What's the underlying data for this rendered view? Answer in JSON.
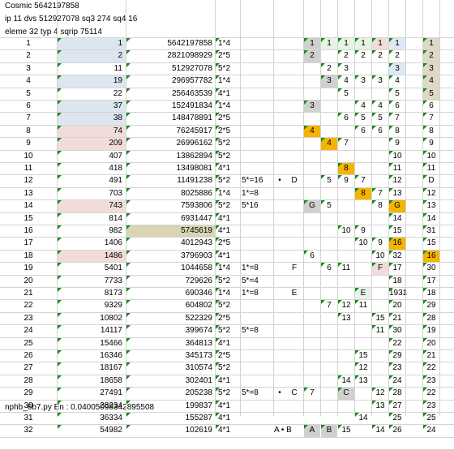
{
  "header": {
    "line1": "Cosmic 5642197858",
    "line2": "ip 11 dvs 512927078 sq3 274 sq4 16",
    "line3": "eleme 32 typ 4 sqrip 75114"
  },
  "footer": "nphb_6b7.py En : 0.04005098342895508",
  "colors": {
    "blue": "#dce6f1",
    "pink": "#f2dcdb",
    "olive": "#d8d4b4",
    "orange": "#f5b400",
    "gray": "#d0d0d0",
    "lightgreen": "#e6f3e6",
    "lightblue": "#ddeaf6",
    "tan": "#ddd9c4",
    "grid": "#d4d4d4"
  },
  "rows": [
    {
      "n": "1",
      "b": "1",
      "c": "5642197858",
      "d": "1*4",
      "e": "",
      "f": "",
      "g": "",
      "s": [
        "1",
        "1",
        "1",
        "1",
        "1",
        "1",
        "1"
      ]
    },
    {
      "n": "2",
      "b": "2",
      "c": "2821098929",
      "d": "2*5",
      "e": "",
      "f": "",
      "g": "",
      "s": [
        "2",
        "",
        "2",
        "2",
        "2",
        "2",
        "2"
      ]
    },
    {
      "n": "3",
      "b": "11",
      "c": "512927078",
      "d": "5*2",
      "e": "",
      "f": "",
      "g": "",
      "s": [
        "",
        "2",
        "3",
        "",
        "",
        "3",
        "3"
      ]
    },
    {
      "n": "4",
      "b": "19",
      "c": "296957782",
      "d": "1*4",
      "e": "",
      "f": "",
      "g": "",
      "s": [
        "",
        "3",
        "4",
        "3",
        "3",
        "4",
        "4"
      ]
    },
    {
      "n": "5",
      "b": "22",
      "c": "256463539",
      "d": "4*1",
      "e": "",
      "f": "",
      "g": "",
      "s": [
        "",
        "",
        "5",
        "",
        "",
        "5",
        "5"
      ]
    },
    {
      "n": "6",
      "b": "37",
      "c": "152491834",
      "d": "1*4",
      "e": "",
      "f": "",
      "g": "",
      "s": [
        "3",
        "",
        "",
        "4",
        "4",
        "6",
        "6"
      ]
    },
    {
      "n": "7",
      "b": "38",
      "c": "148478891",
      "d": "2*5",
      "e": "",
      "f": "",
      "g": "",
      "s": [
        "",
        "",
        "6",
        "5",
        "5",
        "7",
        "7"
      ]
    },
    {
      "n": "8",
      "b": "74",
      "c": "76245917",
      "d": "2*5",
      "e": "",
      "f": "",
      "g": "",
      "s": [
        "4",
        "",
        "",
        "6",
        "6",
        "8",
        "8"
      ]
    },
    {
      "n": "9",
      "b": "209",
      "c": "26996162",
      "d": "5*2",
      "e": "",
      "f": "",
      "g": "",
      "s": [
        "",
        "4",
        "7",
        "",
        "",
        "9",
        "9"
      ]
    },
    {
      "n": "10",
      "b": "407",
      "c": "13862894",
      "d": "5*2",
      "e": "",
      "f": "",
      "g": "",
      "s": [
        "",
        "",
        "",
        "",
        "",
        "10",
        "10"
      ]
    },
    {
      "n": "11",
      "b": "418",
      "c": "13498081",
      "d": "4*1",
      "e": "",
      "f": "",
      "g": "",
      "s": [
        "",
        "",
        "8",
        "",
        "",
        "11",
        "11"
      ]
    },
    {
      "n": "12",
      "b": "491",
      "c": "11491238",
      "d": "5*2",
      "e": "5*=16",
      "f": "•",
      "g": "D",
      "s": [
        "",
        "5",
        "9",
        "7",
        "",
        "12",
        "D"
      ]
    },
    {
      "n": "13",
      "b": "703",
      "c": "8025886",
      "d": "1*4",
      "e": "1*=8",
      "f": "",
      "g": "",
      "s": [
        "",
        "",
        "",
        "8",
        "7",
        "13",
        "12"
      ]
    },
    {
      "n": "14",
      "b": "743",
      "c": "7593806",
      "d": "5*2",
      "e": "5*16",
      "f": "",
      "g": "",
      "s": [
        "G",
        "5",
        "",
        "",
        "8",
        "G",
        "13"
      ]
    },
    {
      "n": "15",
      "b": "814",
      "c": "6931447",
      "d": "4*1",
      "e": "",
      "f": "",
      "g": "",
      "s": [
        "",
        "",
        "",
        "",
        "",
        "14",
        "14"
      ]
    },
    {
      "n": "16",
      "b": "982",
      "c": "5745619",
      "d": "4*1",
      "e": "",
      "f": "",
      "g": "",
      "s": [
        "",
        "",
        "10",
        "9",
        "",
        "15",
        "31"
      ]
    },
    {
      "n": "17",
      "b": "1406",
      "c": "4012943",
      "d": "2*5",
      "e": "",
      "f": "",
      "g": "",
      "s": [
        "",
        "",
        "",
        "10",
        "9",
        "16",
        "15"
      ]
    },
    {
      "n": "18",
      "b": "1486",
      "c": "3796903",
      "d": "4*1",
      "e": "",
      "f": "",
      "g": "",
      "s": [
        "6",
        "",
        "",
        "",
        "10",
        "32",
        "16"
      ]
    },
    {
      "n": "19",
      "b": "5401",
      "c": "1044658",
      "d": "1*4",
      "e": "1*=8",
      "f": "",
      "g": "F",
      "s": [
        "",
        "6",
        "11",
        "",
        "F",
        "17",
        "30"
      ]
    },
    {
      "n": "20",
      "b": "7733",
      "c": "729626",
      "d": "5*2",
      "e": "5*=4",
      "f": "",
      "g": "",
      "s": [
        "",
        "",
        "",
        "",
        "",
        "18",
        "17"
      ]
    },
    {
      "n": "21",
      "b": "8173",
      "c": "690346",
      "d": "1*4",
      "e": "1*=8",
      "f": "",
      "g": "E",
      "s": [
        "",
        "",
        "",
        "E",
        "",
        "1931",
        "18"
      ]
    },
    {
      "n": "22",
      "b": "9329",
      "c": "604802",
      "d": "5*2",
      "e": "",
      "f": "",
      "g": "",
      "s": [
        "",
        "7",
        "12",
        "11",
        "",
        "20",
        "29"
      ]
    },
    {
      "n": "23",
      "b": "10802",
      "c": "522329",
      "d": "2*5",
      "e": "",
      "f": "",
      "g": "",
      "s": [
        "",
        "",
        "13",
        "",
        "15",
        "21",
        "28"
      ]
    },
    {
      "n": "24",
      "b": "14117",
      "c": "399674",
      "d": "5*2",
      "e": "5*=8",
      "f": "",
      "g": "",
      "s": [
        "",
        "",
        "",
        "",
        "11",
        "30",
        "19"
      ]
    },
    {
      "n": "25",
      "b": "15466",
      "c": "364813",
      "d": "4*1",
      "e": "",
      "f": "",
      "g": "",
      "s": [
        "",
        "",
        "",
        "",
        "",
        "22",
        "20"
      ]
    },
    {
      "n": "26",
      "b": "16346",
      "c": "345173",
      "d": "2*5",
      "e": "",
      "f": "",
      "g": "",
      "s": [
        "",
        "",
        "",
        "15",
        "",
        "29",
        "21"
      ]
    },
    {
      "n": "27",
      "b": "18167",
      "c": "310574",
      "d": "5*2",
      "e": "",
      "f": "",
      "g": "",
      "s": [
        "",
        "",
        "",
        "12",
        "",
        "23",
        "22"
      ]
    },
    {
      "n": "28",
      "b": "18658",
      "c": "302401",
      "d": "4*1",
      "e": "",
      "f": "",
      "g": "",
      "s": [
        "",
        "",
        "14",
        "13",
        "",
        "24",
        "23"
      ]
    },
    {
      "n": "29",
      "b": "27491",
      "c": "205238",
      "d": "5*2",
      "e": "5*=8",
      "f": "•",
      "g": "C",
      "s": [
        "7",
        "",
        "C",
        "",
        "12",
        "28",
        "22"
      ]
    },
    {
      "n": "30",
      "b": "28234",
      "c": "199837",
      "d": "4*1",
      "e": "",
      "f": "",
      "g": "",
      "s": [
        "",
        "",
        "",
        "",
        "13",
        "27",
        "23"
      ]
    },
    {
      "n": "31",
      "b": "36334",
      "c": "155287",
      "d": "4*1",
      "e": "",
      "f": "",
      "g": "",
      "s": [
        "",
        "",
        "",
        "14",
        "",
        "25",
        "25"
      ]
    },
    {
      "n": "32",
      "b": "54982",
      "c": "102619",
      "d": "4*1",
      "e": "",
      "f": "A  •  B",
      "g": "",
      "s": [
        "A",
        "B",
        "15",
        "",
        "14",
        "26",
        "24"
      ]
    }
  ]
}
